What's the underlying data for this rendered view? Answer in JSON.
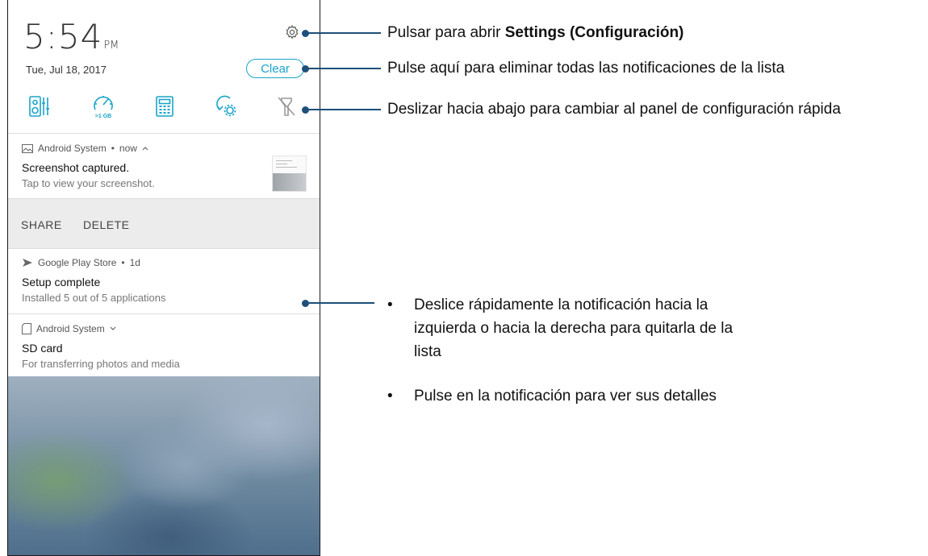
{
  "status": {
    "time": "5:54",
    "ampm": "PM",
    "date": "Tue, Jul 18, 2017",
    "clear_label": "Clear"
  },
  "quick_settings": [
    {
      "icon": "equalizer-icon"
    },
    {
      "icon": "memory-booster-icon",
      "label": ">1 GB"
    },
    {
      "icon": "calculator-icon"
    },
    {
      "icon": "auto-rotate-settings-icon"
    },
    {
      "icon": "flashlight-off-icon"
    }
  ],
  "notifications": [
    {
      "app": "Android System",
      "time": "now",
      "title": "Screenshot captured.",
      "text": "Tap to view your screenshot.",
      "actions": [
        "SHARE",
        "DELETE"
      ]
    },
    {
      "app": "Google Play Store",
      "time": "1d",
      "title": "Setup complete",
      "text": "Installed 5 out of 5 applications"
    },
    {
      "app": "Android System",
      "title": "SD card",
      "text": "For transferring photos and media"
    }
  ],
  "callouts": {
    "settings_prefix": "Pulsar para abrir ",
    "settings_bold": "Settings (Configuración)",
    "clear": "Pulse aquí para eliminar todas las notificaciones de la lista",
    "quick": "Deslizar hacia abajo para cambiar al panel de configuración rápida",
    "bullet1": "Deslice rápidamente la notificación hacia la izquierda o hacia la derecha para quitarla de la lista",
    "bullet2": "Pulse en la notificación para ver sus detalles",
    "bullet_char": "•"
  },
  "colors": {
    "accent": "#1aa4c9",
    "callout_line": "#1d4f7a"
  }
}
